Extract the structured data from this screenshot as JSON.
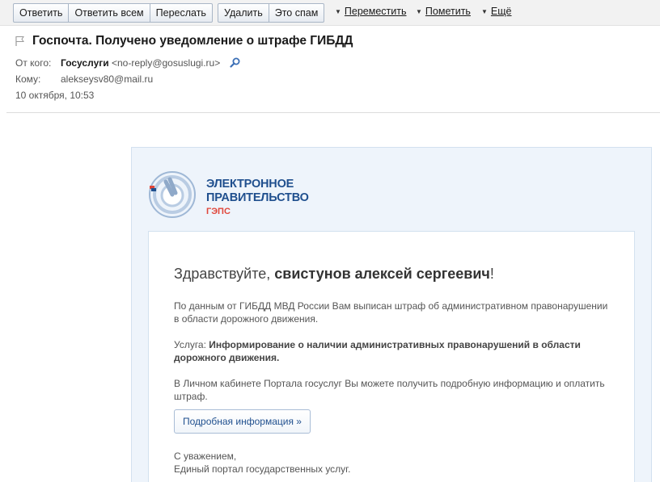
{
  "toolbar": {
    "reply": "Ответить",
    "reply_all": "Ответить всем",
    "forward": "Переслать",
    "delete": "Удалить",
    "spam": "Это спам",
    "move": "Переместить",
    "mark": "Пометить",
    "more": "Ещё"
  },
  "message": {
    "subject": "Госпочта. Получено уведомление о штрафе ГИБДД",
    "from_label": "От кого:",
    "from_name": "Госуслуги",
    "from_email": "<no-reply@gosuslugi.ru>",
    "to_label": "Кому:",
    "to_email": "alekseysv80@mail.ru",
    "date": "10 октября, 10:53"
  },
  "email": {
    "logo": {
      "line1": "ЭЛЕКТРОННОЕ",
      "line2": "ПРАВИТЕЛЬСТВО",
      "line3": "ГЭПС"
    },
    "greeting_prefix": "Здравствуйте, ",
    "greeting_name": "свистунов алексей сергеевич",
    "greeting_suffix": "!",
    "p1": "По данным от ГИБДД МВД России Вам выписан штраф об административном правонарушении в области дорожного движения.",
    "service_label": "Услуга: ",
    "service_value": "Информирование о наличии административных правонарушений в области дорожного движения.",
    "p3": "В Личном кабинете Портала госуслуг Вы можете получить подробную информацию и оплатить штраф.",
    "more_button": "Подробная информация »",
    "regards": "С уважением,",
    "signature": "Единый портал государственных услуг."
  },
  "colors": {
    "brand_blue": "#1f4f8e",
    "brand_red": "#e0463a",
    "email_bg": "#eef4fb"
  }
}
